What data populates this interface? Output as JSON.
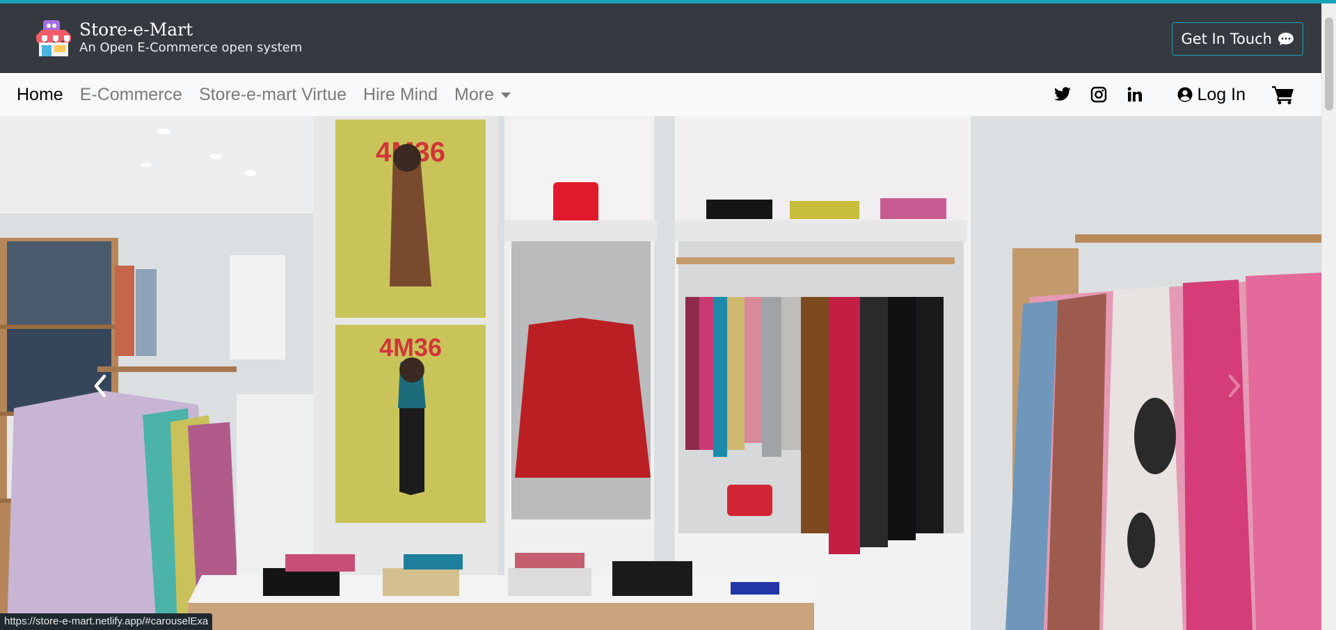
{
  "brand": {
    "title": "Store-e-Mart",
    "subtitle": "An Open E-Commerce open system",
    "logo_icon": "storefront-icon"
  },
  "header": {
    "cta_label": "Get In Touch",
    "cta_icon": "chat-bubble-icon",
    "accent_color": "#17a2b8",
    "bg_color": "#343a40"
  },
  "nav": {
    "items": [
      {
        "label": "Home",
        "active": true
      },
      {
        "label": "E-Commerce"
      },
      {
        "label": "Store-e-mart Virtue"
      },
      {
        "label": "Hire Mind"
      },
      {
        "label": "More"
      }
    ],
    "social": [
      {
        "icon": "twitter-icon"
      },
      {
        "icon": "instagram-icon"
      },
      {
        "icon": "linkedin-icon"
      }
    ],
    "login_label": "Log In",
    "login_icon": "user-circle-icon",
    "cart_icon": "cart-icon"
  },
  "carousel": {
    "prev_icon": "chevron-left-icon",
    "next_icon": "chevron-right-icon",
    "poster_text_1": "4M36",
    "poster_text_2": "4M36"
  },
  "status": {
    "url": "https://store-e-mart.netlify.app/#carouselExa"
  }
}
